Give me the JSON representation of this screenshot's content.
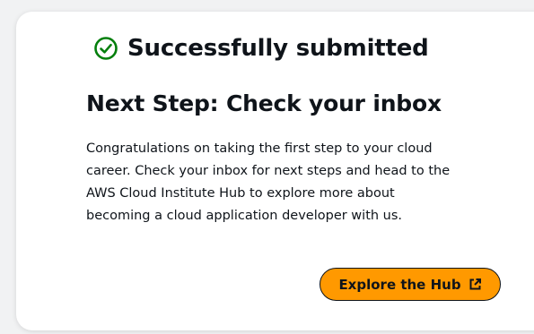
{
  "status": {
    "text": "Successfully submitted",
    "icon": "check-circle-icon",
    "icon_color": "#037f0c"
  },
  "next_step": {
    "heading": "Next Step: Check your inbox",
    "body_lines": [
      "Congratulations on taking the first step to your cloud",
      "career. Check your inbox for next steps and head to the",
      "AWS Cloud Institute Hub to explore more about",
      "becoming a cloud application developer with us."
    ]
  },
  "cta": {
    "label": "Explore the Hub",
    "icon": "external-link-icon",
    "color": "#ff9900"
  }
}
